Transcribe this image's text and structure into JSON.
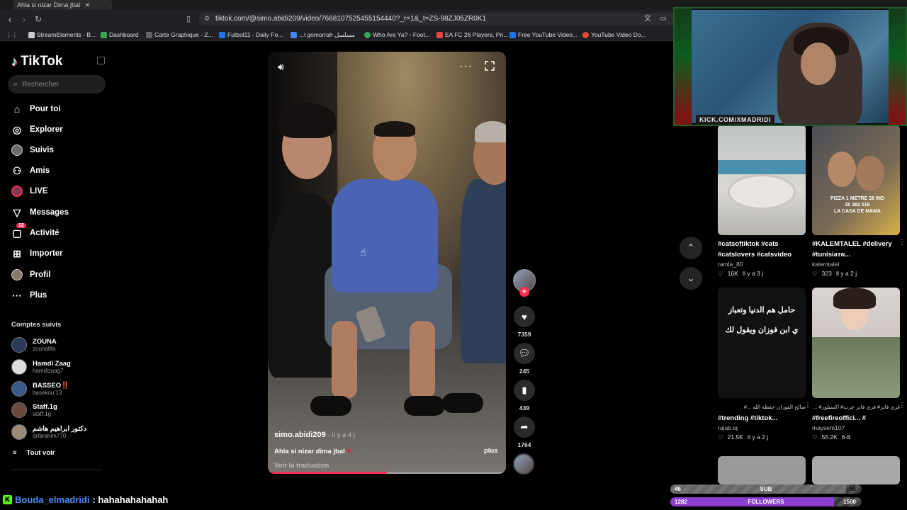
{
  "browser": {
    "tab_title": "Ahla si nizar Dima jbal",
    "url": "tiktok.com/@simo.abidi209/video/7668107525455154440?_r=1&_t=ZS-98ZJ05ZR0K1",
    "bookmarks": [
      {
        "label": "StreamElements - B...",
        "color": "#cccccc"
      },
      {
        "label": "Dashboard",
        "color": "#34a853"
      },
      {
        "label": "Carte Graphique - Z...",
        "color": "#666666"
      },
      {
        "label": "Futbol11 - Daily Fo...",
        "color": "#1a73e8"
      },
      {
        "label": "...l gomorrah مسلسل",
        "color": "#4285f4"
      },
      {
        "label": "Who Are Ya? - Foot...",
        "color": "#34a853"
      },
      {
        "label": "EA FC 26 Players, Pri...",
        "color": "#e8453c"
      },
      {
        "label": "Free YouTube Video...",
        "color": "#1a73e8"
      },
      {
        "label": "YouTube Video Do...",
        "color": "#e8453c"
      }
    ]
  },
  "sidebar": {
    "logo": "TikTok",
    "search_placeholder": "Rechercher",
    "nav": [
      {
        "label": "Pour toi",
        "icon": "home-icon"
      },
      {
        "label": "Explorer",
        "icon": "compass-icon"
      },
      {
        "label": "Suivis",
        "icon": "following-avatar-icon"
      },
      {
        "label": "Amis",
        "icon": "friends-icon"
      },
      {
        "label": "LIVE",
        "icon": "live-icon"
      },
      {
        "label": "Messages",
        "icon": "paper-plane-icon"
      },
      {
        "label": "Activité",
        "icon": "inbox-icon",
        "badge": "12"
      },
      {
        "label": "Importer",
        "icon": "upload-icon"
      },
      {
        "label": "Profil",
        "icon": "profile-avatar-icon"
      },
      {
        "label": "Plus",
        "icon": "more-icon"
      }
    ],
    "following_title": "Comptes suivis",
    "accounts": [
      {
        "name": "ZOUNA",
        "user": "zounafifa"
      },
      {
        "name": "Hamdi Zaag",
        "user": "hamdizaag7"
      },
      {
        "name": "BASSEO‼️",
        "user": "basekou.13"
      },
      {
        "name": "Staff.1g",
        "user": "staff.1g"
      },
      {
        "name": "دكتور ابراهيم هاشم",
        "user": "drIbrahim770"
      }
    ],
    "see_all": "Tout voir"
  },
  "video": {
    "author": "simo.abidi209",
    "age": " · Il y a 4 j",
    "caption": "Ahla si nizar dima jbal",
    "more": "plus",
    "translate": "Voir la traduction",
    "progress": 0.5
  },
  "actions": {
    "likes": "7359",
    "comments": "245",
    "saves": "439",
    "shares": "1764"
  },
  "grid": [
    {
      "title": "#catsoftiktok #cats #catslovers #catsvideo",
      "user": "ramla_80",
      "likes": "16K",
      "age": "Il y a 3 j",
      "thumb_text": ""
    },
    {
      "title": "#KALEMTALEL #delivery #tunisiaᴛɴ...",
      "user": "kalemtalel",
      "likes": "323",
      "age": "Il y a 2 j",
      "thumb_text": "PIZZA 1 METRE 28 IND\n20 382 016\nLA CASA DE MAMA"
    },
    {
      "title": "#trending #tiktok...",
      "user": "rajab.iq",
      "likes": "21.5K",
      "age": "Il y a 2 j",
      "thumb_text": "حامل هم الدنيا وتعباز\nي ابن فوزان ويقول لك",
      "subtitle": "صالح الفوزان حفظه الله ...#"
    },
    {
      "title": "#freefireoffici... #",
      "user": "maysem107",
      "likes": "55.2K",
      "age": "6-8",
      "thumb_text": "",
      "subtitle": "فري فاير# فري فاير عرب# اكسبلور# ..."
    }
  ],
  "webcam": {
    "banner": "KICK.COM/XMADRIDI"
  },
  "chat": {
    "user": "Bouda_elmadridi",
    "message": ": hahahahahahah"
  },
  "goals": [
    {
      "label": "SUB",
      "current": "46",
      "target": "50",
      "fraction": 0.92,
      "color": "#8c8c8c"
    },
    {
      "label": "FOLLOWERS",
      "current": "1282",
      "target": "1500",
      "fraction": 0.855,
      "color": "#8a3fd1"
    }
  ],
  "colors": {
    "accent": "#fe2c55",
    "background": "#000000"
  }
}
